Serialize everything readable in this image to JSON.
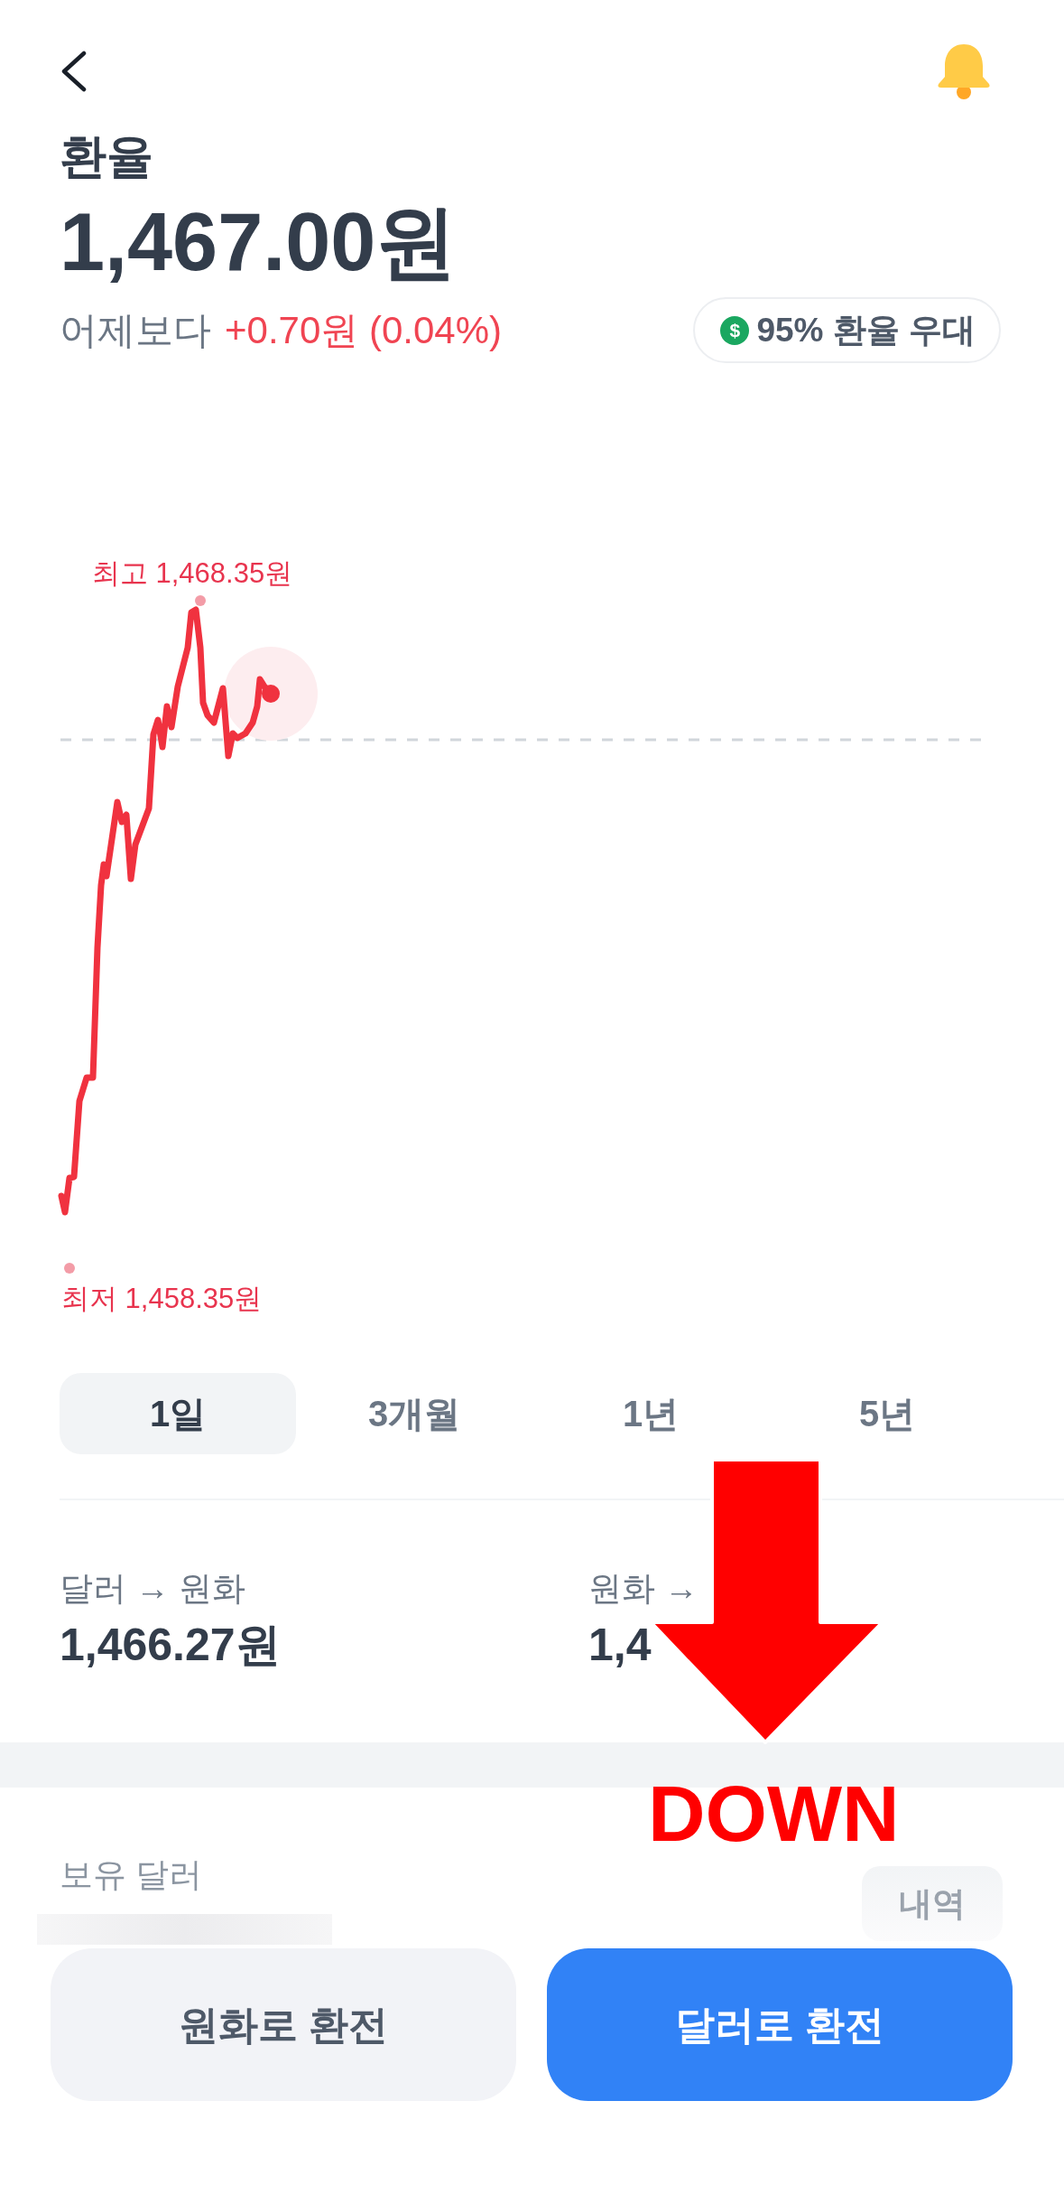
{
  "header": {
    "title": "환율"
  },
  "rate": {
    "value": "1,467.00원",
    "change_label": "어제보다",
    "change": "+0.70원 (0.04%)"
  },
  "badge": {
    "icon": "$",
    "label": "95% 환율 우대"
  },
  "chart": {
    "high_label": "최고 1,468.35원",
    "low_label": "최저 1,458.35원"
  },
  "periods": [
    {
      "label": "1일",
      "selected": true
    },
    {
      "label": "3개월",
      "selected": false
    },
    {
      "label": "1년",
      "selected": false
    },
    {
      "label": "5년",
      "selected": false
    }
  ],
  "rates": [
    {
      "label": "달러 → 원화",
      "value": "1,466.27원"
    },
    {
      "label": "원화 →",
      "value": "1,4"
    }
  ],
  "holdings": {
    "label": "보유 달러",
    "amount_hidden": true,
    "history_button": "내역"
  },
  "actions": [
    {
      "label": "원화로 환전",
      "kind": "secondary"
    },
    {
      "label": "달러로 환전",
      "kind": "primary"
    }
  ],
  "annotation": {
    "label": "DOWN"
  }
}
